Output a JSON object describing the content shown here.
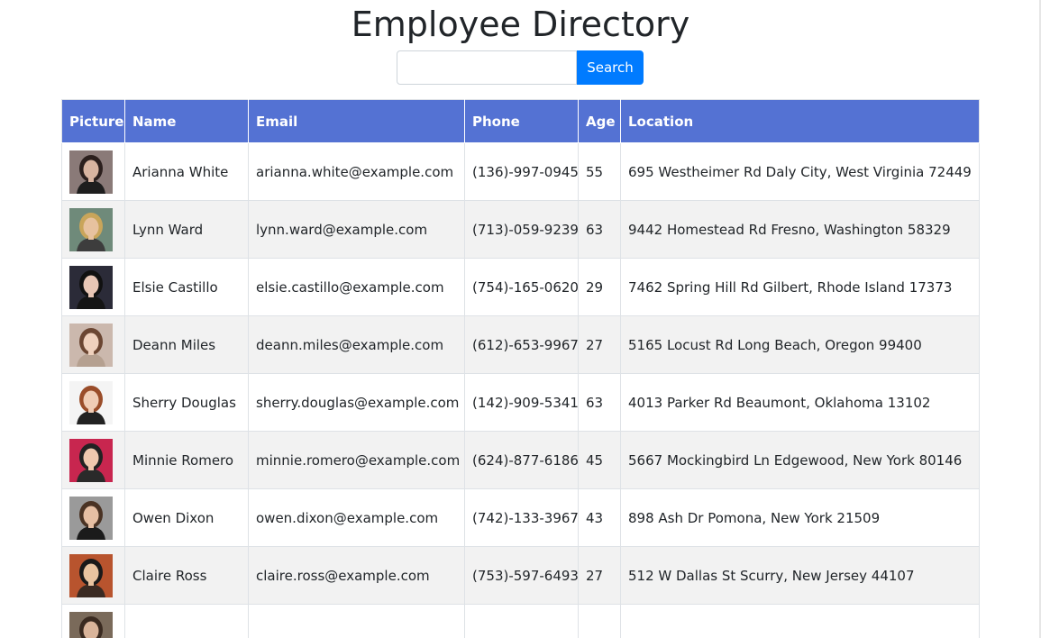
{
  "header": {
    "title": "Employee Directory"
  },
  "search": {
    "placeholder": "",
    "value": "",
    "button_label": "Search",
    "button_color": "#007bff"
  },
  "table": {
    "header_color": "#5472d3",
    "columns": [
      "Picture",
      "Name",
      "Email",
      "Phone",
      "Age",
      "Location"
    ],
    "rows": [
      {
        "avatar": {
          "bg": "#8a7a78",
          "hair": "#2b1f1d",
          "skin": "#d8b4a0",
          "shirt": "#1e1e1e"
        },
        "name": "Arianna White",
        "email": "arianna.white@example.com",
        "phone": "(136)-997-0945",
        "age": "55",
        "location": "695 Westheimer Rd Daly City, West Virginia 72449"
      },
      {
        "avatar": {
          "bg": "#6f8a7a",
          "hair": "#c9a55a",
          "skin": "#e7c29f",
          "shirt": "#3d3d3d"
        },
        "name": "Lynn Ward",
        "email": "lynn.ward@example.com",
        "phone": "(713)-059-9239",
        "age": "63",
        "location": "9442 Homestead Rd Fresno, Washington 58329"
      },
      {
        "avatar": {
          "bg": "#2b2b38",
          "hair": "#111111",
          "skin": "#e8c6b5",
          "shirt": "#151515"
        },
        "name": "Elsie Castillo",
        "email": "elsie.castillo@example.com",
        "phone": "(754)-165-0620",
        "age": "29",
        "location": "7462 Spring Hill Rd Gilbert, Rhode Island 17373"
      },
      {
        "avatar": {
          "bg": "#cbb8ad",
          "hair": "#6b4632",
          "skin": "#efd1bd",
          "shirt": "#b5a090"
        },
        "name": "Deann Miles",
        "email": "deann.miles@example.com",
        "phone": "(612)-653-9967",
        "age": "27",
        "location": "5165 Locust Rd Long Beach, Oregon 99400"
      },
      {
        "avatar": {
          "bg": "#f4f4f4",
          "hair": "#9a4d2a",
          "skin": "#f0cdb6",
          "shirt": "#222222"
        },
        "name": "Sherry Douglas",
        "email": "sherry.douglas@example.com",
        "phone": "(142)-909-5341",
        "age": "63",
        "location": "4013 Parker Rd Beaumont, Oklahoma 13102"
      },
      {
        "avatar": {
          "bg": "#c8264f",
          "hair": "#222222",
          "skin": "#efc8ae",
          "shirt": "#2a2a2a"
        },
        "name": "Minnie Romero",
        "email": "minnie.romero@example.com",
        "phone": "(624)-877-6186",
        "age": "45",
        "location": "5667 Mockingbird Ln Edgewood, New York 80146"
      },
      {
        "avatar": {
          "bg": "#9a9a9a",
          "hair": "#4a3324",
          "skin": "#e6bfa3",
          "shirt": "#1b1b1b"
        },
        "name": "Owen Dixon",
        "email": "owen.dixon@example.com",
        "phone": "(742)-133-3967",
        "age": "43",
        "location": "898 Ash Dr Pomona, New York 21509"
      },
      {
        "avatar": {
          "bg": "#b8542e",
          "hair": "#1a1a1a",
          "skin": "#e9c4a0",
          "shirt": "#3a2a22"
        },
        "name": "Claire Ross",
        "email": "claire.ross@example.com",
        "phone": "(753)-597-6493",
        "age": "27",
        "location": "512 W Dallas St Scurry, New Jersey 44107"
      },
      {
        "avatar": {
          "bg": "#7a6a5a",
          "hair": "#3a2a20",
          "skin": "#d9b49a",
          "shirt": "#2a2a2a"
        },
        "name": "",
        "email": "",
        "phone": "",
        "age": "",
        "location": ""
      }
    ]
  }
}
